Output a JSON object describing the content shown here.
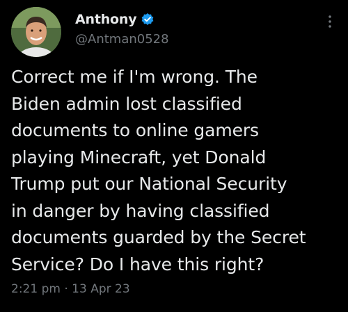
{
  "author": {
    "display_name": "Anthony",
    "handle": "@Antman0528",
    "verified": true
  },
  "tweet": {
    "lines": [
      "Correct me if I'm wrong. The",
      "Biden admin lost classified",
      "documents to online gamers",
      "playing Minecraft, yet Donald",
      "Trump put our National Security",
      "in danger by having classified",
      "documents guarded by the Secret",
      "Service? Do I have this right?"
    ],
    "time": "2:21 pm",
    "separator": "·",
    "date": "13 Apr 23"
  },
  "icons": {
    "verified": "verified-badge-icon",
    "more": "more-options-icon"
  },
  "colors": {
    "background": "#000000",
    "text_primary": "#e7e9ea",
    "text_secondary": "#71767b",
    "verified_blue": "#1d9bf0"
  }
}
